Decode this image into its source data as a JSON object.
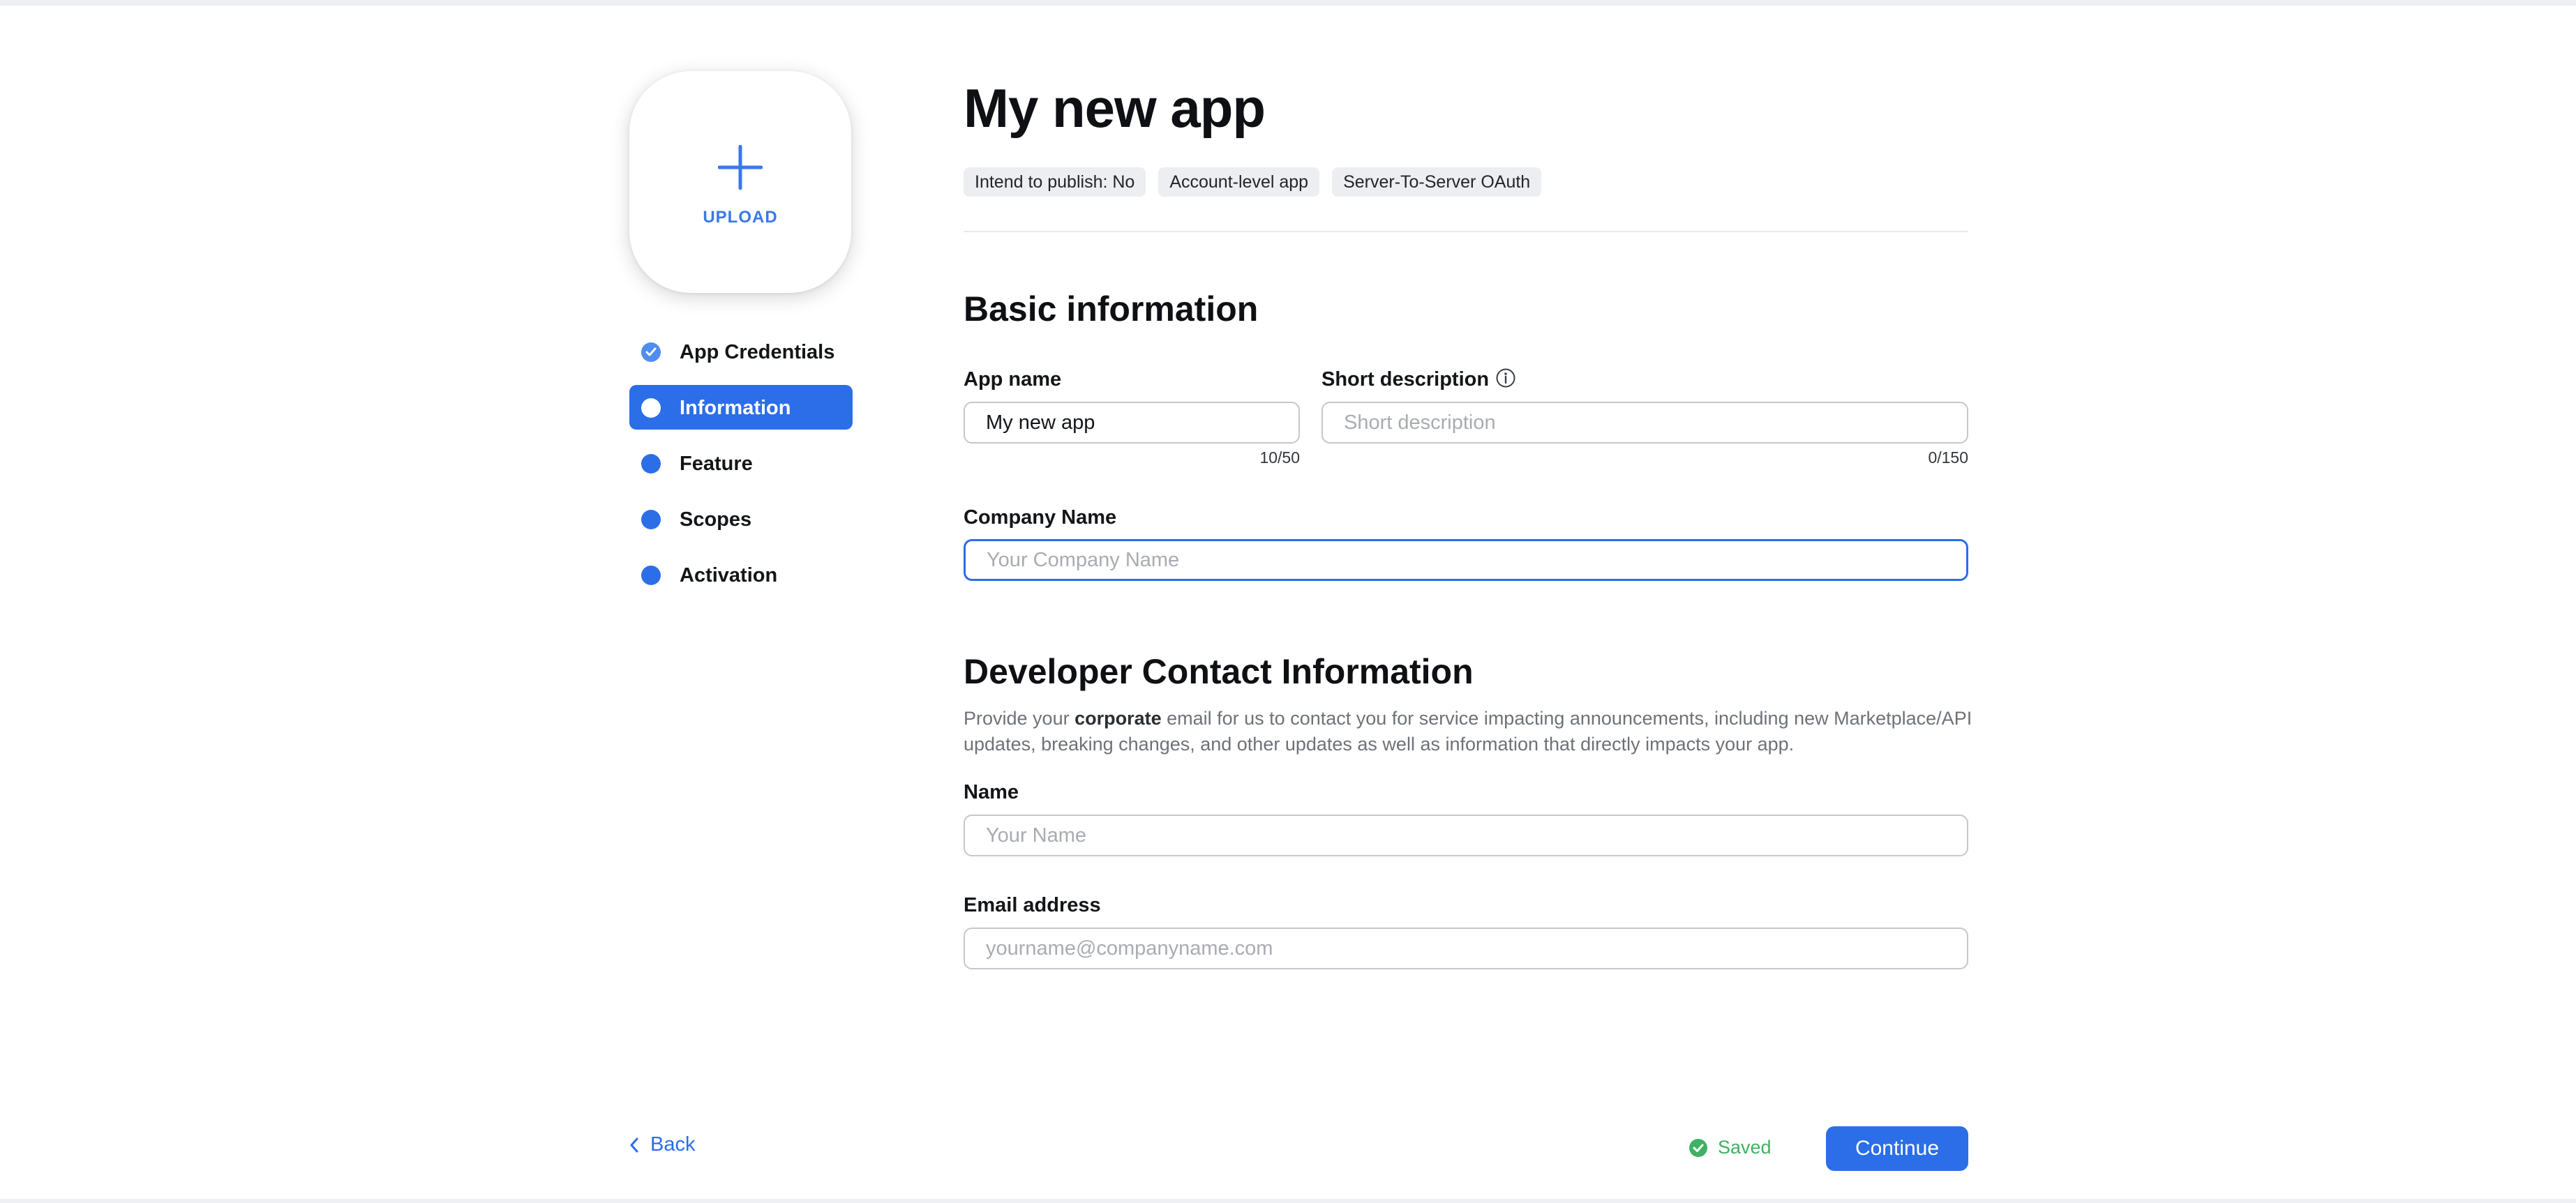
{
  "app": {
    "title": "My new app",
    "tags": [
      "Intend to publish: No",
      "Account-level app",
      "Server-To-Server OAuth"
    ]
  },
  "upload": {
    "label": "UPLOAD",
    "icon": "plus-icon"
  },
  "steps": [
    {
      "label": "App Credentials",
      "state": "completed",
      "icon": "check-circle-icon"
    },
    {
      "label": "Information",
      "state": "active"
    },
    {
      "label": "Feature",
      "state": "pending"
    },
    {
      "label": "Scopes",
      "state": "pending"
    },
    {
      "label": "Activation",
      "state": "pending"
    }
  ],
  "basic_info": {
    "heading": "Basic information",
    "app_name": {
      "label": "App name",
      "value": "My new app",
      "counter": "10/50"
    },
    "short_description": {
      "label": "Short description",
      "placeholder": "Short description",
      "value": "",
      "counter": "0/150",
      "icon": "info-icon"
    },
    "company_name": {
      "label": "Company Name",
      "placeholder": "Your Company Name",
      "value": ""
    }
  },
  "developer_contact": {
    "heading": "Developer Contact Information",
    "description_before": "Provide your ",
    "description_bold": "corporate",
    "description_after": " email for us to contact you for service impacting announcements, including new Marketplace/API updates, breaking changes, and other updates as well as information that directly impacts your app.",
    "name": {
      "label": "Name",
      "placeholder": "Your Name",
      "value": ""
    },
    "email": {
      "label": "Email address",
      "placeholder": "yourname@companyname.com",
      "value": ""
    }
  },
  "footer": {
    "back_label": "Back",
    "saved_label": "Saved",
    "continue_label": "Continue"
  },
  "colors": {
    "primary": "#2b6ee8",
    "saved": "#3fb164",
    "tag_bg": "#eceef1"
  }
}
